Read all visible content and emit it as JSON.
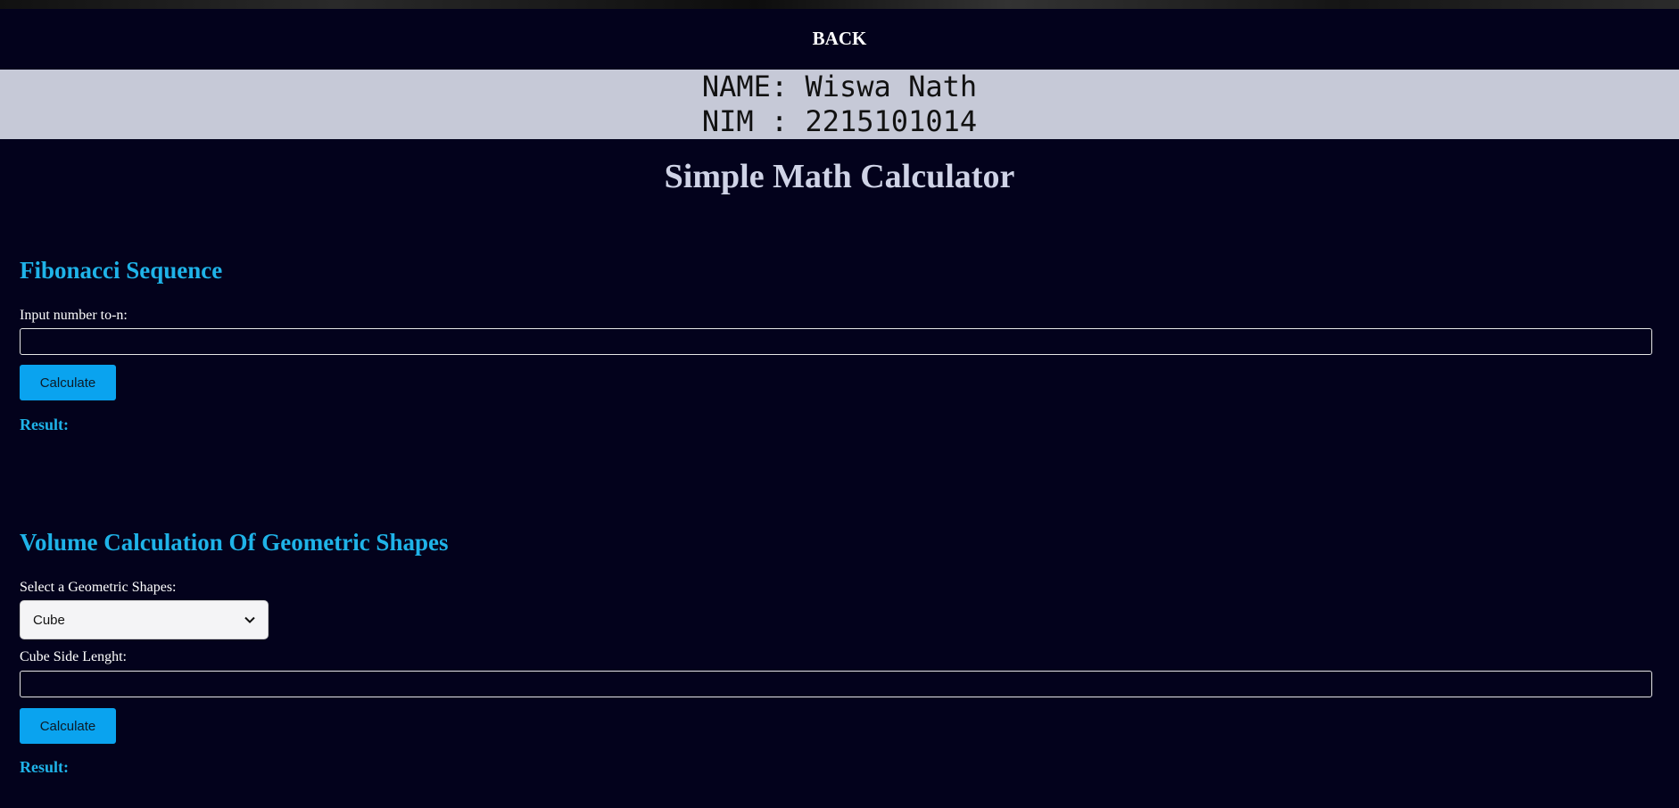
{
  "nav": {
    "back_label": "BACK"
  },
  "banner": {
    "name_line": "NAME: Wiswa Nath",
    "nim_line": "NIM : 2215101014"
  },
  "page": {
    "title": "Simple Math Calculator"
  },
  "fibonacci": {
    "title": "Fibonacci Sequence",
    "input_label": "Input number to-n:",
    "input_value": "",
    "button_label": "Calculate",
    "result_label": "Result:"
  },
  "volume": {
    "title": "Volume Calculation Of Geometric Shapes",
    "select_label": "Select a Geometric Shapes:",
    "select_value": "Cube",
    "side_label": "Cube Side Lenght:",
    "input_value": "",
    "button_label": "Calculate",
    "result_label": "Result:"
  },
  "colors": {
    "background": "#03021c",
    "banner": "#c6c9d7",
    "accent": "#1fb3e8",
    "button": "#0aa3ef"
  },
  "icons": {
    "select_chevron": "chevron-down-icon"
  }
}
